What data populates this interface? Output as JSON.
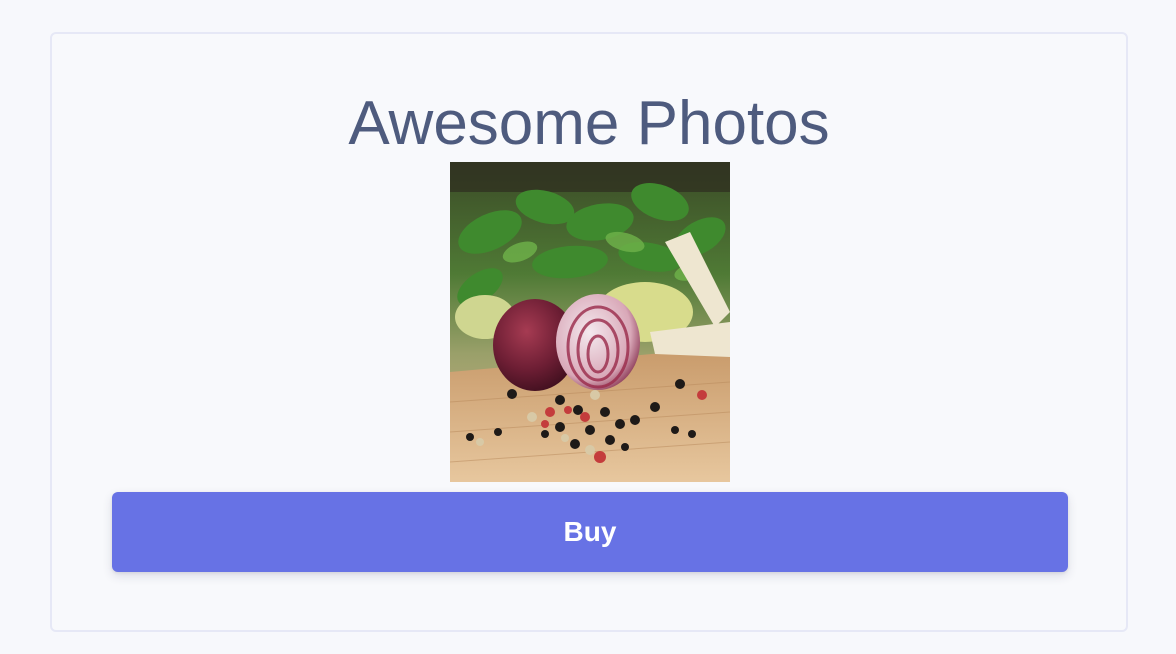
{
  "card": {
    "title": "Awesome Photos",
    "buy_label": "Buy"
  },
  "colors": {
    "page_background": "#f7f8fc",
    "card_border": "#e6e8f6",
    "title_text": "#4e5b7e",
    "button_background": "#6772e5",
    "button_text": "#ffffff"
  },
  "photo": {
    "subject": "red onion halves, whole peppercorns, parsley and parsnips on a wooden board"
  }
}
